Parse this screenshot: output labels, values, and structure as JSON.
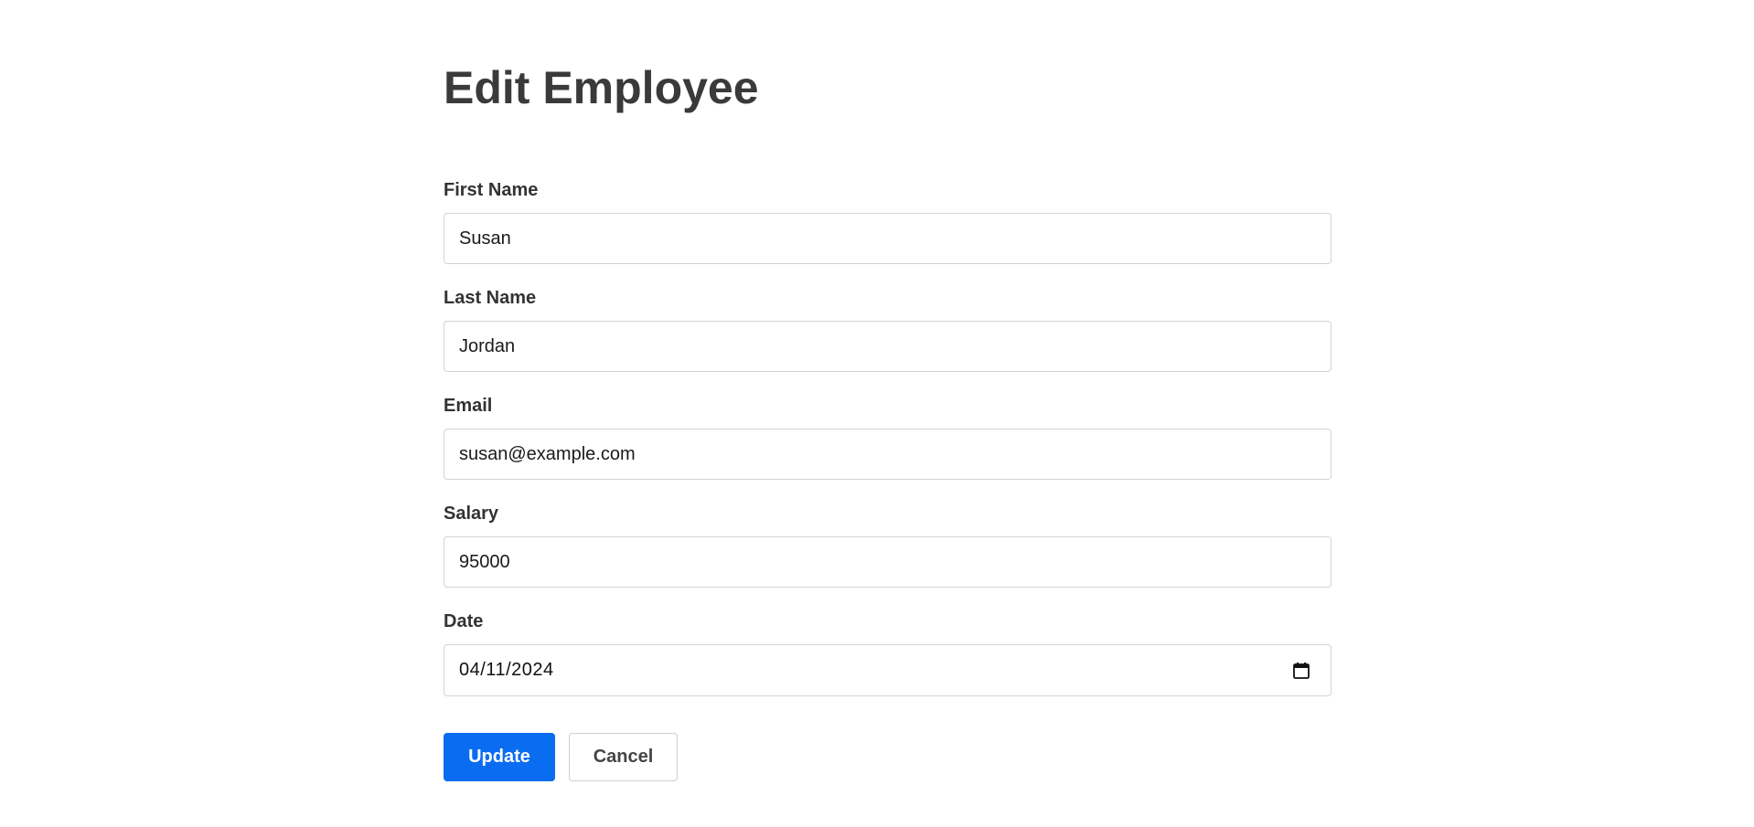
{
  "page": {
    "title": "Edit Employee"
  },
  "form": {
    "first_name": {
      "label": "First Name",
      "value": "Susan"
    },
    "last_name": {
      "label": "Last Name",
      "value": "Jordan"
    },
    "email": {
      "label": "Email",
      "value": "susan@example.com"
    },
    "salary": {
      "label": "Salary",
      "value": "95000"
    },
    "date": {
      "label": "Date",
      "value": "04/11/2024",
      "icon": "calendar-icon"
    }
  },
  "actions": {
    "update_label": "Update",
    "cancel_label": "Cancel"
  },
  "colors": {
    "primary": "#0a6cf0",
    "text": "#333333",
    "border": "#d4d4d4"
  }
}
